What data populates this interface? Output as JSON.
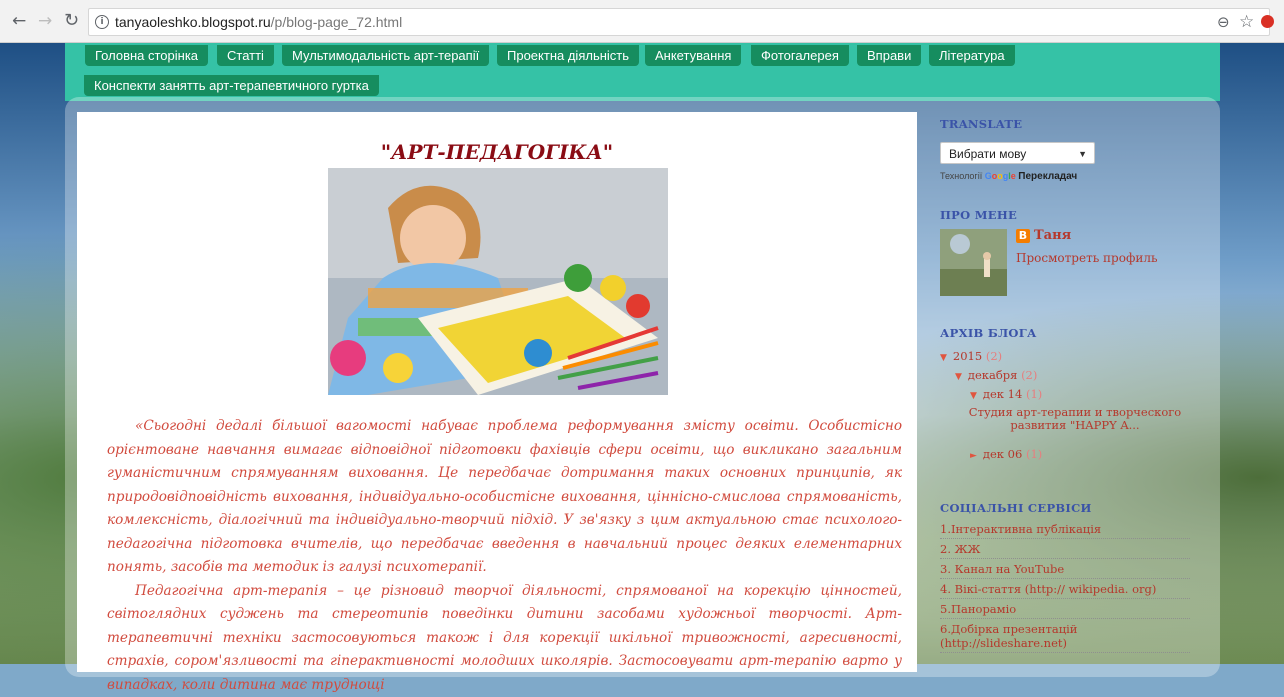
{
  "browser": {
    "url_host": "tanyaoleshko.blogspot.ru",
    "url_path": "/p/blog-page_72.html"
  },
  "tabs": [
    "Головна сторінка",
    "Статті",
    "Мультимодальність арт-терапії",
    "Проектна діяльність",
    "Анкетування",
    "Фотогалерея",
    "Вправи",
    "Література",
    "Конспекти занятть арт-терапевтичного гуртка"
  ],
  "post": {
    "title": "\"АРТ-ПЕДАГОГІКА\"",
    "paragraph_1": "«Сьогодні дедалі більшої вагомості набуває проблема реформування змісту освіти. Особистісно орієнтоване навчання вимагає відповідної підготовки фахівців сфери освіти, що викликано загальним гуманістичним спрямуванням виховання. Це передбачає дотримання таких основних принципів, як природовідповідність виховання, індивідуально-особистісне виховання, ціннісно-смислова спрямованість, комлексність, діалогічний та індивідуально-творчий підхід. У зв'язку з цим актуальною стає психолого-педагогічна підготовка вчителів, що передбачає введення в навчальний процес деяких елементарних понять, засобів та методик із галузі психотерапії.",
    "paragraph_2": "Педагогічна арт-терапія – це різновид творчої діяльності, спрямованої на корекцію цінностей, світоглядних суджень та стереотипів поведінки дитини засобами художньої творчості. Арт-терапевтичні техніки застосовуються також і для корекції шкільної тривожності, агресивності, страхів, сором'язливості та гіперактивності молодших школярів. Застосовувати арт-терапію варто у випадках, коли дитина має труднощі"
  },
  "sidebar": {
    "translate": {
      "heading": "TRANSLATE",
      "select_value": "Вибрати мову",
      "powered_prefix": "Технології",
      "powered_brand": "Google",
      "powered_suffix": "Перекладач"
    },
    "about": {
      "heading": "ПРО МЕНЕ",
      "name": "Таня",
      "profile_link": "Просмотреть профиль"
    },
    "archive": {
      "heading": "АРХІВ БЛОГА",
      "year": "2015",
      "year_count": "(2)",
      "month": "декабря",
      "month_count": "(2)",
      "day1": "дек 14",
      "day1_count": "(1)",
      "day1_post": "Студия арт-терапии и творческого развития \"HAPPY A...",
      "day2": "дек 06",
      "day2_count": "(1)"
    },
    "social": {
      "heading": "СОЦІАЛЬНІ СЕРВІСИ",
      "items": [
        "1.Інтерактивна публікація",
        "2. ЖЖ",
        "3. Канал на YouTube",
        "4. Вікі-стаття (http:// wikipedia. org)",
        "5.Панораміо",
        "6.Добірка презентацій (http://slideshare.net)"
      ]
    }
  },
  "colors": {
    "tab_bar": "#35c2a6",
    "tab": "#168d5f",
    "title": "#8a0c14",
    "body_text": "#d14b3e",
    "sidebar_heading": "#3a53a8",
    "link": "#b5382c"
  }
}
